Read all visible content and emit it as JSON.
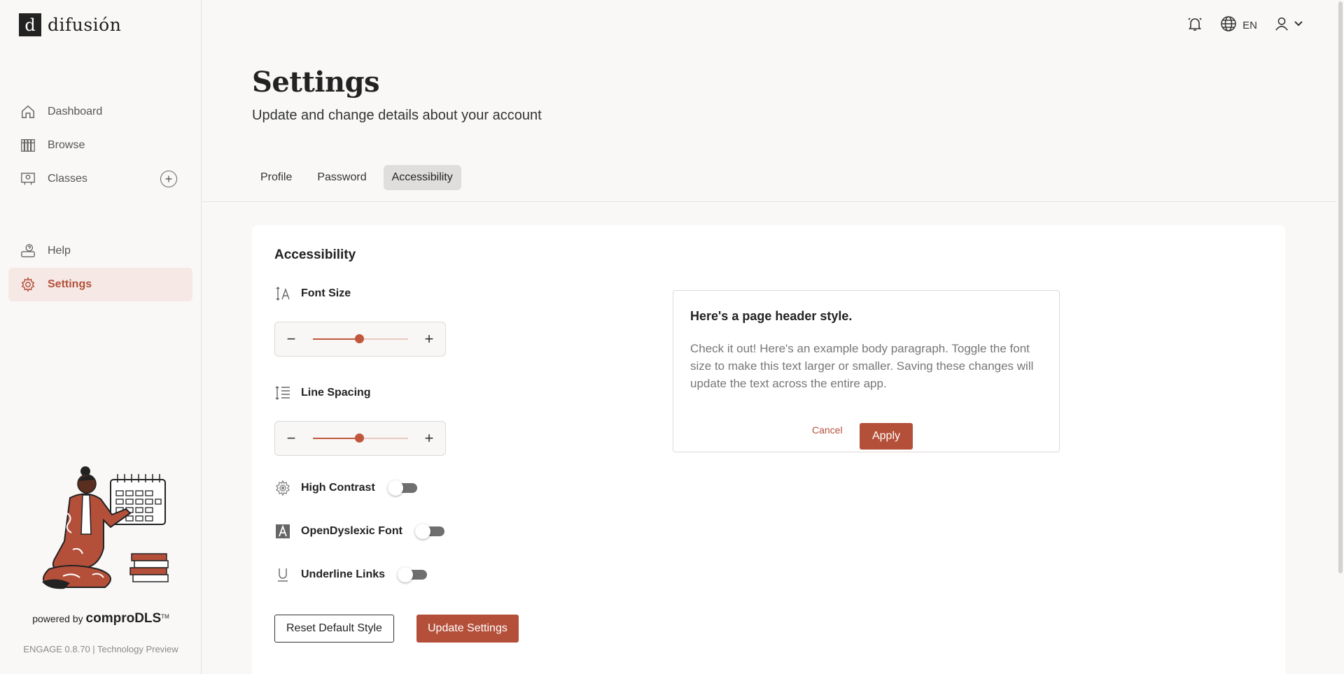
{
  "brand": {
    "logo_mark": "d",
    "name": "difusión"
  },
  "sidebar": {
    "items": [
      {
        "label": "Dashboard",
        "icon": "home-icon"
      },
      {
        "label": "Browse",
        "icon": "library-icon"
      },
      {
        "label": "Classes",
        "icon": "classroom-icon"
      },
      {
        "label": "Help",
        "icon": "help-icon"
      },
      {
        "label": "Settings",
        "icon": "gear-icon",
        "active": true
      }
    ],
    "add_class_icon": "plus-circle-icon",
    "powered_prefix": "powered by",
    "powered_brand": "comproDLS",
    "powered_tm": "TM",
    "version": "ENGAGE 0.8.70 | Technology Preview"
  },
  "topbar": {
    "notification_icon": "bell-icon",
    "language_icon": "globe-icon",
    "language": "EN",
    "user_icon": "user-icon",
    "menu_icon": "chevron-down-icon"
  },
  "header": {
    "title": "Settings",
    "subtitle": "Update and change details about your account"
  },
  "tabs": [
    {
      "label": "Profile"
    },
    {
      "label": "Password"
    },
    {
      "label": "Accessibility",
      "active": true
    }
  ],
  "accessibility": {
    "title": "Accessibility",
    "font_size": {
      "label": "Font Size",
      "level": 0.49
    },
    "line_spacing": {
      "label": "Line Spacing",
      "level": 0.49
    },
    "high_contrast": {
      "label": "High Contrast",
      "enabled": false
    },
    "dyslexic_font": {
      "label": "OpenDyslexic Font",
      "enabled": false
    },
    "underline_links": {
      "label": "Underline Links",
      "enabled": false
    },
    "reset_label": "Reset Default Style",
    "update_label": "Update Settings",
    "minus_label": "−",
    "plus_label": "+"
  },
  "preview": {
    "title": "Here's a page header style.",
    "body": "Check it out! Here's an example body paragraph. Toggle the font size to make this text larger or smaller. Saving these changes will update the text across the entire app.",
    "cancel_label": "Cancel",
    "apply_label": "Apply"
  },
  "colors": {
    "accent": "#b4503a",
    "active_nav_bg": "#f6e9e5",
    "page_bg": "#f9f8f7"
  }
}
